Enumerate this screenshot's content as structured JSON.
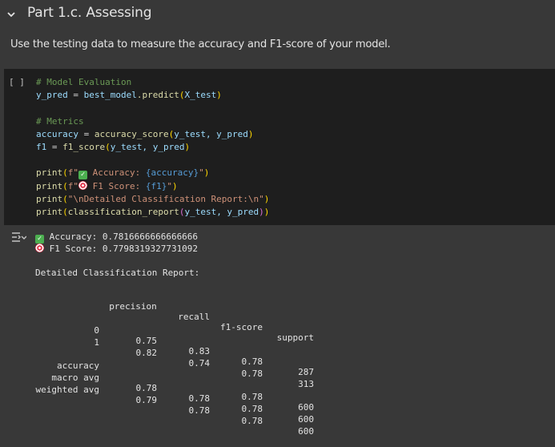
{
  "section": {
    "title": "Part 1.c. Assessing",
    "description": "Use the testing data to measure the accuracy and F1-score of your model."
  },
  "cell": {
    "run_indicator": "[ ]",
    "code": {
      "line1_comment": "# Model Evaluation",
      "line2_var": "y_pred",
      "line2_op": " = ",
      "line2_obj": "best_model",
      "line2_method": ".predict",
      "line2_arg": "X_test",
      "line4_comment": "# Metrics",
      "line5_var": "accuracy",
      "line5_fn": "accuracy_score",
      "line5_args": "y_test, y_pred",
      "line6_var": "f1",
      "line6_fn": "f1_score",
      "line6_args": "y_test, y_pred",
      "line8_fn": "print",
      "line8_prefix": "f\"",
      "line8_text": " Accuracy: ",
      "line8_expr": "{accuracy}",
      "line9_text": " F1 Score: ",
      "line9_expr": "{f1}",
      "line10_str": "\"\\nDetailed Classification Report:\\n\"",
      "line11_fn": "classification_report",
      "line11_args": "y_test, y_pred"
    }
  },
  "output": {
    "accuracy_line": " Accuracy: 0.7816666666666666",
    "f1_line": " F1 Score: 0.7798319327731092",
    "report_title": "Detailed Classification Report:",
    "headers": [
      "precision",
      "recall",
      "f1-score",
      "support"
    ],
    "rows": [
      {
        "label": "0",
        "precision": "0.75",
        "recall": "0.83",
        "f1": "0.78",
        "support": "287"
      },
      {
        "label": "1",
        "precision": "0.82",
        "recall": "0.74",
        "f1": "0.78",
        "support": "313"
      },
      {
        "label": "accuracy",
        "precision": "",
        "recall": "",
        "f1": "0.78",
        "support": "600"
      },
      {
        "label": "macro avg",
        "precision": "0.78",
        "recall": "0.78",
        "f1": "0.78",
        "support": "600"
      },
      {
        "label": "weighted avg",
        "precision": "0.79",
        "recall": "0.78",
        "f1": "0.78",
        "support": "600"
      }
    ]
  },
  "colors": {
    "background": "#383838",
    "code_background": "#1e1e1e",
    "check_green": "#4caf50",
    "target_red": "#e53950"
  },
  "icons": {
    "collapse": "chevron-down-icon",
    "output": "output-toggle-icon",
    "check": "check-mark-emoji",
    "target": "direct-hit-emoji"
  }
}
